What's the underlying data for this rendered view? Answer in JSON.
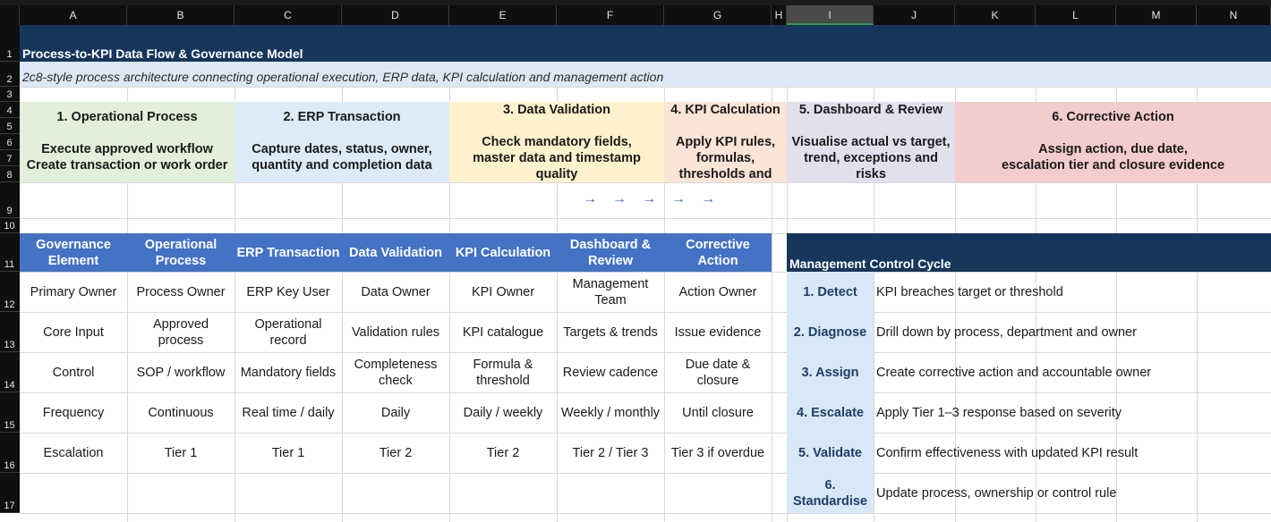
{
  "columns": [
    "A",
    "B",
    "C",
    "D",
    "E",
    "F",
    "G",
    "H",
    "I",
    "J",
    "K",
    "L",
    "M",
    "N"
  ],
  "rows": [
    "1",
    "2",
    "3",
    "4",
    "5",
    "6",
    "7",
    "8",
    "9",
    "10",
    "11",
    "12",
    "13",
    "14",
    "15",
    "16",
    "17"
  ],
  "title": "Process-to-KPI Data Flow & Governance Model",
  "subtitle": "2c8-style process architecture connecting operational execution, ERP data, KPI calculation and management action",
  "stages": [
    {
      "title": "1. Operational Process",
      "desc1": "Execute approved workflow",
      "desc2": "Create transaction or work order",
      "color": "#e2efda"
    },
    {
      "title": "2. ERP Transaction",
      "desc1": "Capture dates, status, owner,",
      "desc2": "quantity and completion data",
      "color": "#ddebf7"
    },
    {
      "title": "3. Data Validation",
      "desc1": "Check mandatory fields,",
      "desc2": "master data and timestamp",
      "desc3": "quality",
      "color": "#fff2cc"
    },
    {
      "title": "4. KPI Calculation",
      "desc1": "Apply KPI rules,",
      "desc2": "formulas,",
      "desc3": "thresholds and",
      "color": "#fce4d6"
    },
    {
      "title": "5. Dashboard & Review",
      "desc1": "Visualise actual vs target,",
      "desc2": "trend, exceptions and",
      "desc3": "risks",
      "color": "#e4dfec"
    },
    {
      "title": "6. Corrective Action",
      "desc1": "Assign action, due date,",
      "desc2": "escalation tier and closure evidence",
      "color": "#f4cccc"
    }
  ],
  "arrows": [
    "→",
    "→",
    "→",
    "→",
    "→"
  ],
  "governance": {
    "headers": [
      "Governance Element",
      "Operational Process",
      "ERP Transaction",
      "Data Validation",
      "KPI Calculation",
      "Dashboard & Review",
      "Corrective Action"
    ],
    "rows": [
      [
        "Primary Owner",
        "Process Owner",
        "ERP Key User",
        "Data Owner",
        "KPI Owner",
        "Management Team",
        "Action Owner"
      ],
      [
        "Core Input",
        "Approved process",
        "Operational record",
        "Validation rules",
        "KPI catalogue",
        "Targets & trends",
        "Issue evidence"
      ],
      [
        "Control",
        "SOP / workflow",
        "Mandatory fields",
        "Completeness check",
        "Formula & threshold",
        "Review cadence",
        "Due date & closure"
      ],
      [
        "Frequency",
        "Continuous",
        "Real time / daily",
        "Daily",
        "Daily / weekly",
        "Weekly / monthly",
        "Until closure"
      ],
      [
        "Escalation",
        "Tier 1",
        "Tier 1",
        "Tier 2",
        "Tier 2",
        "Tier 2 / Tier 3",
        "Tier 3 if overdue"
      ]
    ]
  },
  "control_cycle": {
    "title": "Management Control Cycle",
    "steps": [
      {
        "step": "1. Detect",
        "desc": "KPI breaches target or threshold"
      },
      {
        "step": "2. Diagnose",
        "desc": "Drill down by process, department and owner"
      },
      {
        "step": "3. Assign",
        "desc": "Create corrective action and accountable owner"
      },
      {
        "step": "4. Escalate",
        "desc": "Apply Tier 1–3 response based on severity"
      },
      {
        "step": "5. Validate",
        "desc": "Confirm effectiveness with updated KPI result"
      },
      {
        "step": "6. Standardise",
        "desc": "Update process, ownership or control rule"
      }
    ]
  },
  "colors": {
    "title_band": "#16365c",
    "header_blue": "#4472c4",
    "step_fill": "#d9e8f6",
    "subtitle_band": "#dce9f5"
  }
}
